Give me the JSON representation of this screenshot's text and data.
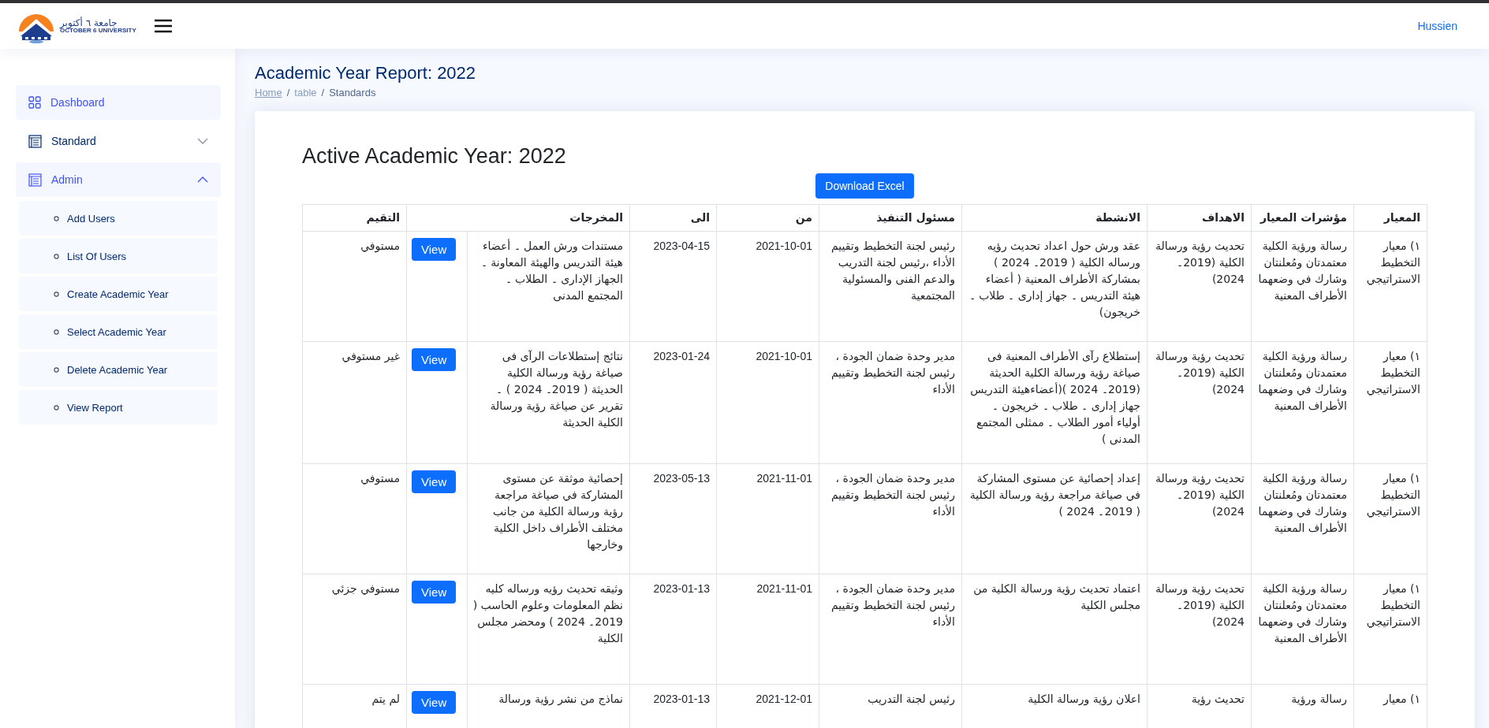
{
  "header": {
    "logo_arabic": "جامعة ٦ أكتوبر",
    "logo_english": "OCTOBER 6 UNIVERSITY",
    "user": "Hussien"
  },
  "sidebar": {
    "items": [
      {
        "label": "Dashboard",
        "selected": true
      },
      {
        "label": "Standard",
        "selected": false,
        "expanded": false
      },
      {
        "label": "Admin",
        "selected": true,
        "expanded": true,
        "children": [
          {
            "label": "Add Users"
          },
          {
            "label": "List Of Users"
          },
          {
            "label": "Create Academic Year"
          },
          {
            "label": "Select Academic Year"
          },
          {
            "label": "Delete Academic Year"
          },
          {
            "label": "View Report"
          }
        ]
      }
    ]
  },
  "page": {
    "title": "Academic Year Report: 2022",
    "breadcrumb": {
      "home_link": "Home",
      "separator_1": "/",
      "section_link": "table",
      "separator_2": "/",
      "current": "Standards"
    }
  },
  "card": {
    "heading": "Active Academic Year: 2022",
    "download_button": "Download Excel",
    "table": {
      "columns": [
        "المعيار",
        "مؤشرات المعيار",
        "الاهداف",
        "الانشطة",
        "مسئول التنفيذ",
        "من",
        "الى",
        "المخرجات",
        "التقيم"
      ],
      "rows": [
        {
          "standard": "١) معيار التخطيط الاستراتيجي",
          "indicators": "رسالة ورؤية الكلية معتمدتان ومُعلنتان وشارك في وضعهما الأطراف المعنية",
          "goals": "تحديث رؤية ورسالة الكلية (2019۔ 2024)",
          "activities": "عقد ورش حول اعداد تحديث رؤيه ورساله الكلية ( 2019۔ 2024 ) بمشاركة الأطراف المعنية ( أعضاء هيئة التدريس ۔ جهاز إدارى ۔ طلاب ۔ خريجون)",
          "responsible": "رئيس لجنة التخطيط وتقييم الأداء ،رئيس لجنة التدريب والدعم الفنى والمسئولية المجتمعية",
          "from": "2021-10-01",
          "to": "2023-04-15",
          "outputs": "مستندات ورش العمل ۔ أعضاء هيئة التدريس والهيئة المعاونة ۔ الجهاز الإدارى ۔ الطلاب ۔ المجتمع المدنى",
          "view": "View",
          "rating": "مستوفي"
        },
        {
          "standard": "١) معيار التخطيط الاستراتيجي",
          "indicators": "رسالة ورؤية الكلية معتمدتان ومُعلنتان وشارك في وضعهما الأطراف المعنية",
          "goals": "تحديث رؤية ورسالة الكلية (2019۔ 2024)",
          "activities": "إستطلاع رآى الأطراف المعنية فى صياغة رؤية ورسالة الكلية الحديثة (2019۔ 2024 )(أعضاءهيئة التدريس جهاز إدارى ۔ طلاب ۔ خريجون ۔ أولياء أمور الطلاب ۔ ممثلى المجتمع المدنى )",
          "responsible": "مدير وحدة ضمان الجودة ، رئيس لجنة التخطيط وتقييم الأداء",
          "from": "2021-10-01",
          "to": "2023-01-24",
          "outputs": "نتائج إستطلاعات الرآى فى صياغة رؤية ورسالة الكلية الحديثة ( 2019۔ 2024 ) ۔ تقرير عن صياغة رؤية ورسالة الكلية الحديثة",
          "view": "View",
          "rating": "غير مستوفي"
        },
        {
          "standard": "١) معيار التخطيط الاستراتيجي",
          "indicators": "رسالة ورؤية الكلية معتمدتان ومُعلنتان وشارك في وضعهما الأطراف المعنية",
          "goals": "تحديث رؤية ورسالة الكلية (2019۔ 2024)",
          "activities": "إعداد إحصائية عن مستوى المشاركة في صياغة مراجعة رؤية ورسالة الكلية ( 2019۔ 2024 )",
          "responsible": "مدير وحدة ضمان الجودة ، رئيس لجنة التخطيط وتقييم الأداء",
          "from": "2021-11-01",
          "to": "2023-05-13",
          "outputs": "إحصائية موثقة عن مستوى المشاركة في صياغة مراجعة رؤية ورسالة الكلية من جانب مختلف الأطراف داخل الكلية وخارجها",
          "view": "View",
          "rating": "مستوفي"
        },
        {
          "standard": "١) معيار التخطيط الاستراتيجي",
          "indicators": "رسالة ورؤية الكلية معتمدتان ومُعلنتان وشارك في وضعهما الأطراف المعنية",
          "goals": "تحديث رؤية ورسالة الكلية (2019۔ 2024)",
          "activities": "اعتماد تحديث رؤية ورسالة الكلية من مجلس الكلية",
          "responsible": "مدير وحدة ضمان الجودة ، رئيس لجنة التخطيط وتقييم الأداء",
          "from": "2021-11-01",
          "to": "2023-01-13",
          "outputs": "وثيقه تحديث رؤيه ورساله كليه نظم المعلومات وعلوم الحاسب ( 2019۔ 2024 ) ومحضر مجلس الكلية",
          "view": "View",
          "rating": "مستوفي جزئي"
        },
        {
          "standard": "١) معيار",
          "indicators": "رسالة ورؤية",
          "goals": "تحديث رؤية",
          "activities": "اعلان رؤية ورسالة الكلية",
          "responsible": "رئيس لجنة التدريب",
          "from": "2021-12-01",
          "to": "2023-01-13",
          "outputs": "نماذج من نشر رؤية ورسالة",
          "view": "View",
          "rating": "لم يتم"
        }
      ]
    }
  }
}
